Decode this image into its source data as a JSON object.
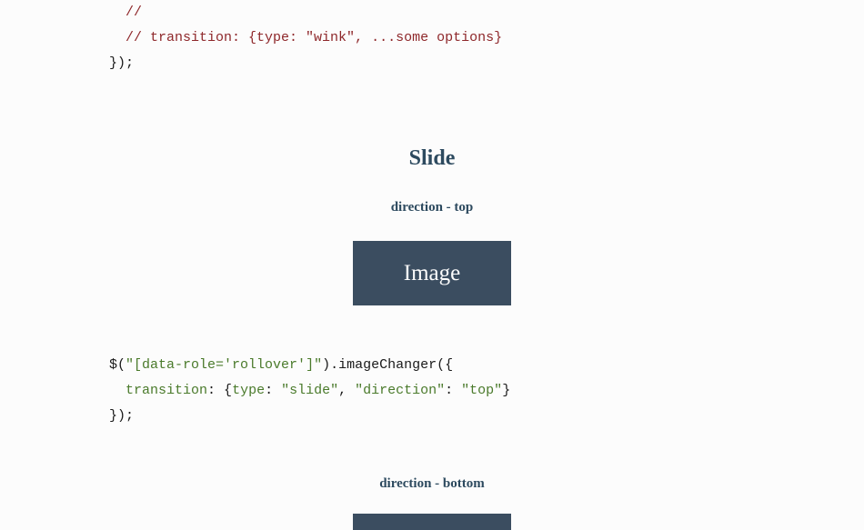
{
  "code1": {
    "line1": "  //",
    "line2_a": "  // transition: {type: ",
    "line2_b": "\"wink\"",
    "line2_c": ", ...some options}",
    "line3": "});"
  },
  "section": {
    "title": "Slide"
  },
  "example1": {
    "heading": "direction - top",
    "image_label": "Image",
    "code": {
      "dollar": "$",
      "selector": "\"[data-role='rollover']\"",
      "method": ".imageChanger({",
      "indent": "  ",
      "key_transition": "transition",
      "colon_space": ": ",
      "brace_open": "{",
      "key_type": "type",
      "val_type": "\"slide\"",
      "comma": ", ",
      "key_direction": "\"direction\"",
      "val_direction": "\"top\"",
      "brace_close": "}",
      "close": "});"
    }
  },
  "example2": {
    "heading": "direction - bottom"
  }
}
